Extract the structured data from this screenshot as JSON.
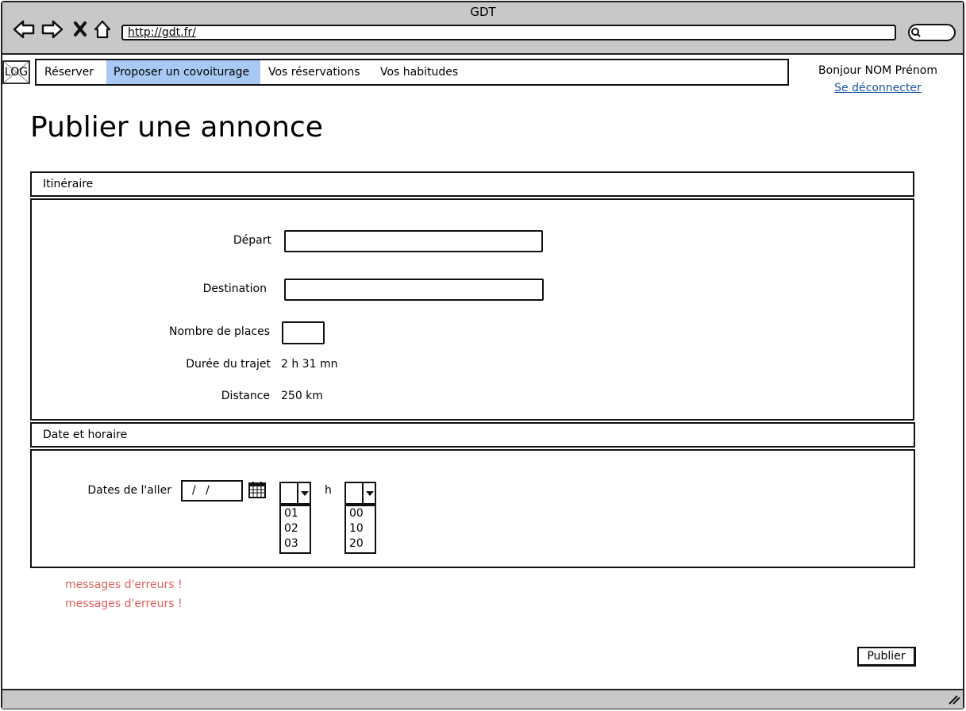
{
  "window": {
    "title": "GDT"
  },
  "browser": {
    "back_icon": "back-arrow-icon",
    "forward_icon": "forward-arrow-icon",
    "stop_icon": "close-icon",
    "home_icon": "home-icon",
    "url": "http://gdt.fr/"
  },
  "nav": {
    "logo": "LOG",
    "items": [
      {
        "label": "Réserver",
        "active": false
      },
      {
        "label": "Proposer un covoiturage",
        "active": true
      },
      {
        "label": "Vos réservations",
        "active": false
      },
      {
        "label": "Vos habitudes",
        "active": false
      }
    ],
    "greeting": "Bonjour NOM Prénom",
    "logout": "Se déconnecter"
  },
  "page": {
    "title": "Publier une annonce"
  },
  "itinerary": {
    "header": "Itinéraire",
    "depart_label": "Départ",
    "depart_value": "",
    "destination_label": "Destination",
    "destination_value": "",
    "seats_label": "Nombre de places",
    "seats_value": "",
    "duration_label": "Durée du trajet",
    "duration_value": "2 h 31 mn",
    "distance_label": "Distance",
    "distance_value": "250 km"
  },
  "schedule": {
    "header": "Date et horaire",
    "dates_label": "Dates de l'aller",
    "date_value": "/ /",
    "hour_sep": "h",
    "hour_options": [
      "01",
      "02",
      "03"
    ],
    "minute_options": [
      "00",
      "10",
      "20"
    ]
  },
  "errors": [
    "messages d'erreurs !",
    "messages d'erreurs !"
  ],
  "actions": {
    "publish": "Publier"
  },
  "colors": {
    "active_tab": "#a9c9f5",
    "error": "#e0605e",
    "link": "#1a56a6",
    "chrome": "#c8c8c8"
  }
}
